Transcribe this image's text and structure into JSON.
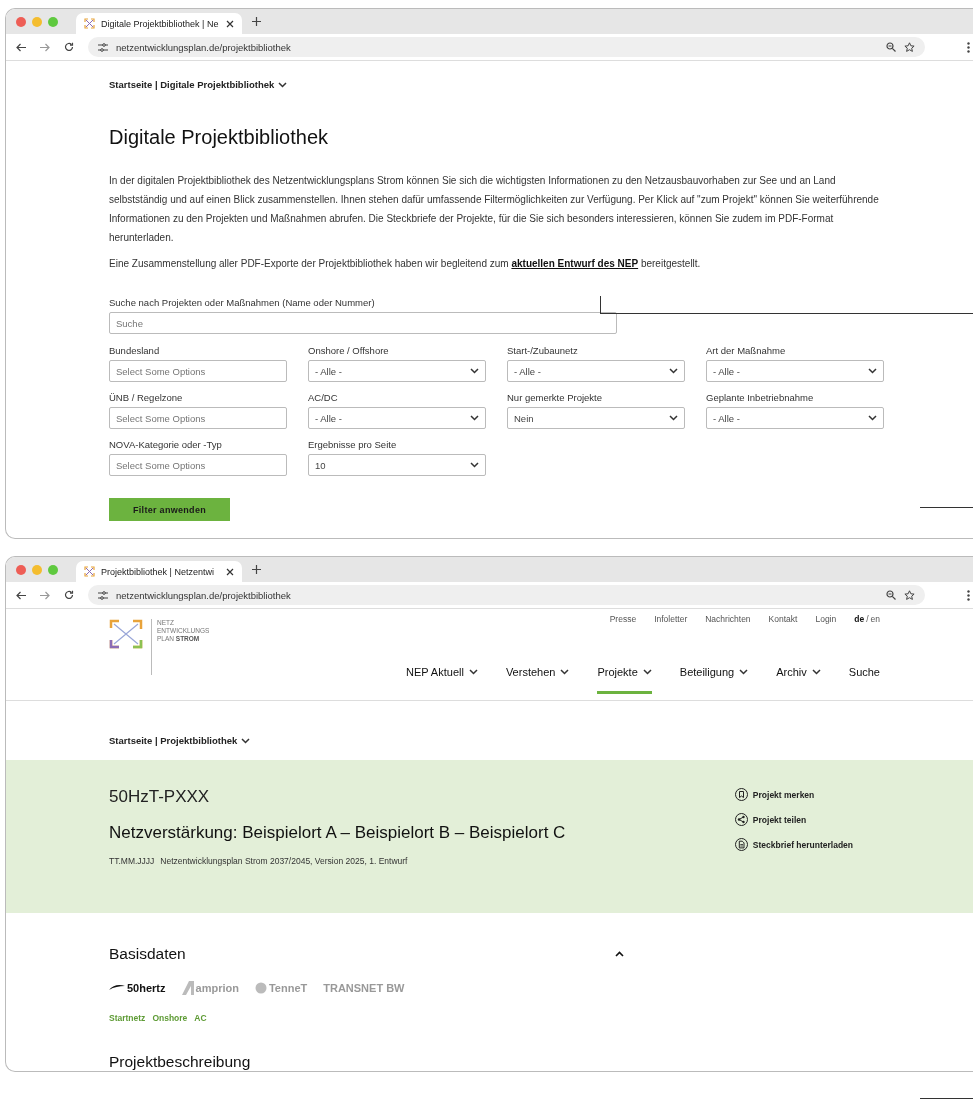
{
  "windows": [
    {
      "kind": "library",
      "tab_title": "Digitale Projektbibliothek | Ne",
      "url": "netzentwicklungsplan.de/projektbibliothek",
      "breadcrumb": "Startseite | Digitale Projektbibliothek",
      "heading": "Digitale Projektbibliothek",
      "intro": "In der digitalen Projektbibliothek des Netzentwicklungsplans Strom können Sie sich die wichtigsten Informationen zu den Netzausbauvorhaben zur See und an Land selbstständig und auf einen Blick zusammenstellen. Ihnen stehen dafür umfassende Filtermöglichkeiten zur Verfügung. Per Klick auf \"zum Projekt\" können Sie weiterführende Informationen zu den Projekten und Maßnahmen abrufen. Die Steckbriefe der Projekte, für die Sie sich besonders interessieren, können Sie zudem im PDF-Format herunterladen.",
      "note": {
        "before": "Eine Zusammenstellung aller PDF-Exporte der Projektbibliothek haben wir begleitend zum",
        "link": "aktuellen Entwurf des NEP",
        "after": "bereitgestellt."
      },
      "search": {
        "label": "Suche nach Projekten oder Maßnahmen (Name oder Nummer)",
        "placeholder": "Suche"
      },
      "filters": [
        {
          "kind": "multiselect",
          "label": "Bundesland",
          "placeholder": "Select Some Options"
        },
        {
          "kind": "select",
          "label": "Onshore / Offshore",
          "value": "- Alle -"
        },
        {
          "kind": "select",
          "label": "Start-/Zubaunetz",
          "value": "- Alle -"
        },
        {
          "kind": "select",
          "label": "Art der Maßnahme",
          "value": "- Alle -"
        },
        {
          "kind": "multiselect",
          "label": "ÜNB / Regelzone",
          "placeholder": "Select Some Options"
        },
        {
          "kind": "select",
          "label": "AC/DC",
          "value": "- Alle -"
        },
        {
          "kind": "select",
          "label": "Nur gemerkte Projekte",
          "value": "Nein"
        },
        {
          "kind": "select",
          "label": "Geplante Inbetriebnahme",
          "value": "- Alle -"
        },
        {
          "kind": "multiselect",
          "label": "NOVA-Kategorie oder -Typ",
          "placeholder": "Select Some Options"
        },
        {
          "kind": "select",
          "label": "Ergebnisse pro Seite",
          "value": "10"
        }
      ],
      "submit": "Filter anwenden"
    },
    {
      "kind": "project",
      "tab_title": "Projektbibliothek | Netzentwi",
      "url": "netzentwicklungsplan.de/projektbibliothek",
      "logo_lines": [
        "NETZ",
        "ENTWICKLUNGS",
        "PLAN **STROM**"
      ],
      "service_links": [
        "Presse",
        "Infoletter",
        "Nachrichten",
        "Kontakt",
        "Login"
      ],
      "languages": [
        {
          "label": "de",
          "selected": true
        },
        {
          "label": "en",
          "selected": false
        }
      ],
      "language_separator": "/",
      "nav": [
        {
          "label": "NEP Aktuell",
          "dropdown": true,
          "selected": false
        },
        {
          "label": "Verstehen",
          "dropdown": true,
          "selected": false
        },
        {
          "label": "Projekte",
          "dropdown": true,
          "selected": true
        },
        {
          "label": "Beteiligung",
          "dropdown": true,
          "selected": false
        },
        {
          "label": "Archiv",
          "dropdown": true,
          "selected": false
        },
        {
          "label": "Suche",
          "dropdown": false,
          "selected": false
        }
      ],
      "breadcrumb": "Startseite | Projektbibliothek",
      "hero": {
        "code": "50HzT-PXXX",
        "title": "Netzverstärkung: Beispielort A – Beispielort B – Beispielort C",
        "date": "TT.MM.JJJJ",
        "meta": "Netzentwicklungsplan Strom 2037/2045, Version 2025, 1. Entwurf",
        "actions": [
          {
            "kind": "bookmark",
            "label": "Projekt merken"
          },
          {
            "kind": "share",
            "label": "Projekt teilen"
          },
          {
            "kind": "download",
            "label": "Steckbrief herunterladen"
          }
        ]
      },
      "basis": {
        "heading": "Basisdaten",
        "expanded": true,
        "operators": [
          {
            "kind": "fiftyhertz",
            "name": "50hertz",
            "selected": true
          },
          {
            "kind": "amprion",
            "name": "amprion",
            "selected": false
          },
          {
            "kind": "tennet",
            "name": "TenneT",
            "selected": false
          },
          {
            "kind": "transnet",
            "name": "TRANSNET BW",
            "selected": false
          }
        ],
        "tags": [
          "Startnetz",
          "Onshore",
          "AC"
        ]
      },
      "next_heading": "Projektbeschreibung"
    }
  ]
}
